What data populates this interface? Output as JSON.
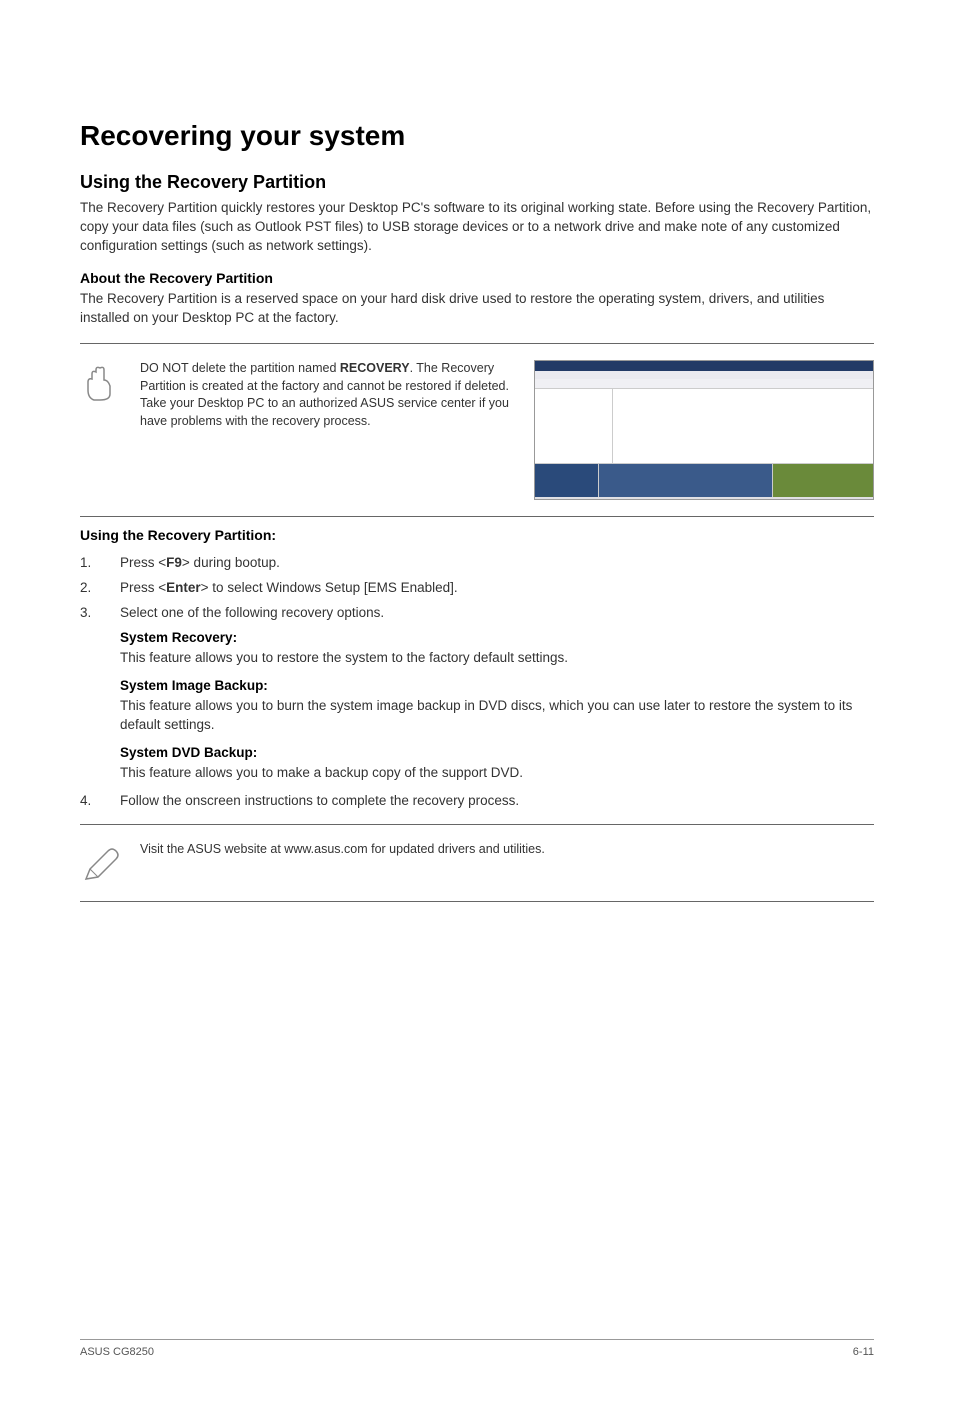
{
  "main_title": "Recovering your system",
  "using_partition": {
    "title": "Using the Recovery Partition",
    "paragraph": "The Recovery Partition quickly restores your Desktop PC's software to its original working state. Before using the Recovery Partition, copy your data files (such as Outlook PST files) to USB storage devices or to a network drive and make note of any customized configuration settings (such as network settings)."
  },
  "about_partition": {
    "title": "About the Recovery Partition",
    "paragraph": "The Recovery Partition is a reserved space on your hard disk drive used to restore the operating system, drivers, and utilities installed on your Desktop PC at the factory."
  },
  "note1_pre": "DO NOT delete the partition named ",
  "note1_bold": "RECOVERY",
  "note1_post": ". The Recovery Partition is created at the factory and cannot be restored if deleted. Take your Desktop PC to an authorized ASUS service center if you have problems with the recovery process.",
  "using_title": "Using the Recovery Partition:",
  "steps": {
    "1": {
      "num": "1.",
      "pre": "Press <",
      "key": "F9",
      "post": "> during bootup."
    },
    "2": {
      "num": "2.",
      "pre": "Press <",
      "key": "Enter",
      "post": "> to select Windows Setup [EMS Enabled]."
    },
    "3": {
      "num": "3.",
      "text": "Select one of the following recovery options."
    },
    "4": {
      "num": "4.",
      "text": "Follow the onscreen instructions to complete the recovery process."
    }
  },
  "options": {
    "sr": {
      "head": "System Recovery:",
      "text": "This feature allows you to restore the system to the factory default settings."
    },
    "sib": {
      "head": "System Image Backup:",
      "text": "This feature allows you to burn the system image backup in DVD discs, which you can use later to restore the system to its default settings."
    },
    "sdb": {
      "head": "System DVD Backup:",
      "text": "This feature allows you to make a backup copy of the support DVD."
    }
  },
  "note2": "Visit the ASUS website at www.asus.com for updated drivers and utilities.",
  "footer_left": "ASUS CG8250",
  "footer_right": "6-11"
}
